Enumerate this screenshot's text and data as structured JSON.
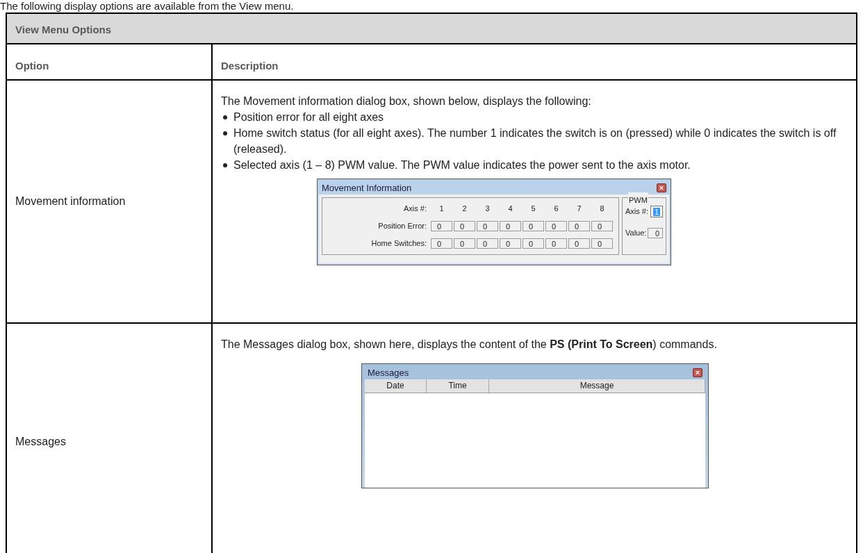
{
  "intro": "The following display options are available from the View menu.",
  "table": {
    "title": "View Menu Options",
    "columns": [
      "Option",
      "Description"
    ],
    "rows": [
      {
        "option": "Movement information",
        "text": "The Movement information dialog box, shown below, displays the following:",
        "bullets": [
          "Position error for all eight axes",
          "Home switch status (for all eight axes). The number 1 indicates the switch is on (pressed) while 0 indicates the switch is off (released).",
          "Selected axis (1 – 8) PWM value. The PWM value indicates the power sent to the axis motor."
        ],
        "dialog": {
          "kind": "movement",
          "title": "Movement Information",
          "close": "×",
          "axis_label": "Axis #:",
          "axes": [
            "1",
            "2",
            "3",
            "4",
            "5",
            "6",
            "7",
            "8"
          ],
          "rows": [
            {
              "label": "Position Error:",
              "values": [
                "0",
                "0",
                "0",
                "0",
                "0",
                "0",
                "0",
                "0"
              ]
            },
            {
              "label": "Home Switches:",
              "values": [
                "0",
                "0",
                "0",
                "0",
                "0",
                "0",
                "0",
                "0"
              ]
            }
          ],
          "pwm": {
            "title": "PWM",
            "axis_label": "Axis #:",
            "axis_value": "1",
            "value_label": "Value:",
            "value": "0"
          }
        }
      },
      {
        "option": "Messages",
        "text": "The Messages dialog box, shown here, displays the content of the **PS (Print To Screen**) commands.",
        "bullets": [],
        "dialog": {
          "kind": "messages",
          "title": "Messages",
          "close": "×",
          "columns": [
            "Date",
            "Time",
            "Message"
          ]
        }
      }
    ]
  }
}
